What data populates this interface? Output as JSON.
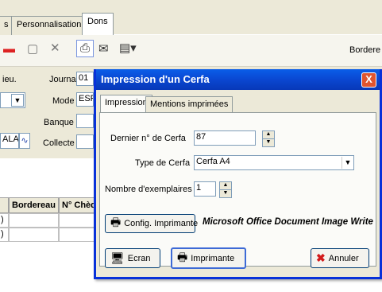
{
  "app": {
    "tabs": [
      "s",
      "Personnalisation",
      "Dons"
    ],
    "toolbar": {
      "bordereau_label": "Bordere"
    },
    "form": {
      "lieu_label": "ieu.",
      "journal_label": "Journal",
      "journal_value": "01",
      "mode_label": "Mode",
      "mode_value": "ESP",
      "banque_label": "Banque",
      "collecte_label": "Collecte",
      "left_value": "ALAI"
    },
    "grid": {
      "columns": [
        "Bordereau",
        "N° Chèq"
      ],
      "rows": [
        ")",
        ")"
      ]
    }
  },
  "dialog": {
    "title": "Impression d'un Cerfa",
    "close_glyph": "X",
    "tabs": [
      "Impression",
      "Mentions imprimées"
    ],
    "fields": {
      "last_cerfa_label": "Dernier n° de Cerfa",
      "last_cerfa_value": "87",
      "type_label": "Type de Cerfa",
      "type_value": "Cerfa A4",
      "copies_label": "Nombre d'exemplaires",
      "copies_value": "1"
    },
    "config_button": "Config. Imprimante",
    "printer_name": "Microsoft Office Document Image Write",
    "buttons": {
      "screen": "Ecran",
      "printer": "Imprimante",
      "cancel": "Annuler"
    }
  }
}
